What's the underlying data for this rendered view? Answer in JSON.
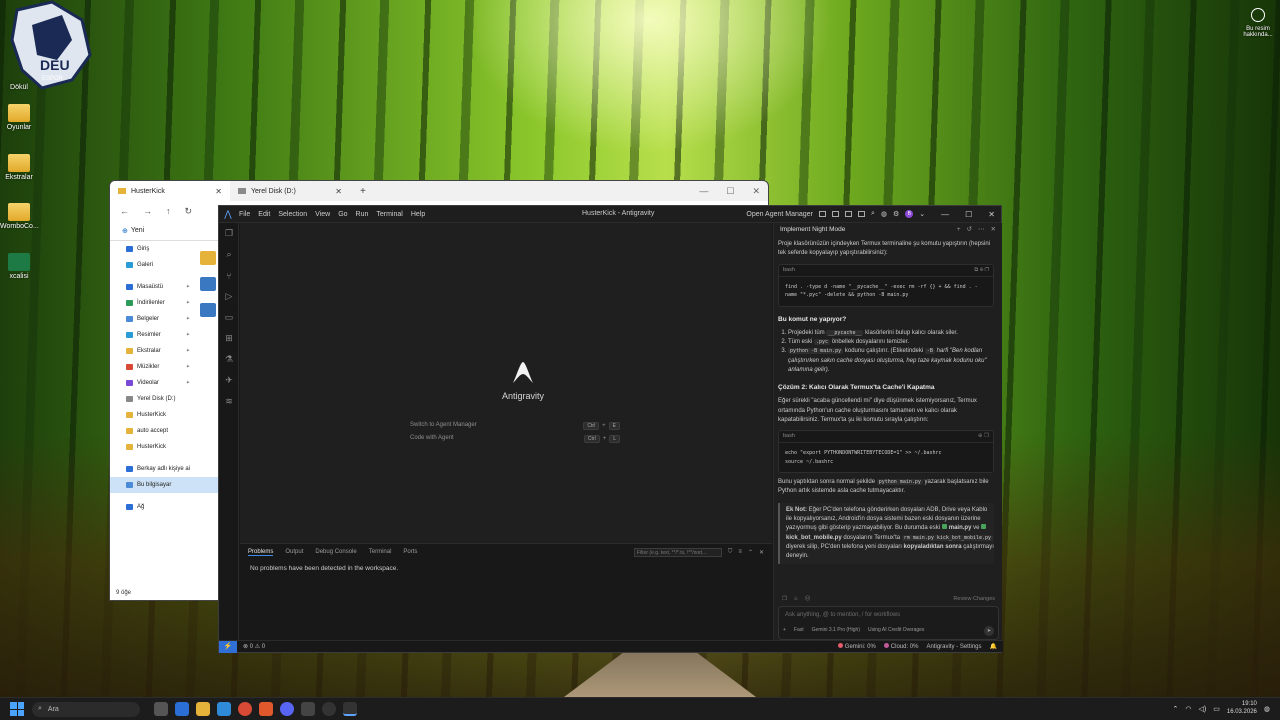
{
  "desktop": {
    "icons": [
      {
        "label": "Oyunlar"
      },
      {
        "label": "Ekstralar"
      },
      {
        "label": "WomboCo..."
      },
      {
        "label": "xcalisi"
      }
    ],
    "partial_label_top": "Dökül",
    "logo_text": "DEU ESPOR",
    "bing_label": "Bu resim hakkında..."
  },
  "explorer": {
    "tabs": [
      {
        "label": "HusterKick"
      },
      {
        "label": "Yerel Disk (D:)"
      }
    ],
    "new_tab": "+",
    "new_label": "Yeni",
    "sidebar": [
      "Giriş",
      "Galeri",
      "Masaüstü",
      "İndirilenler",
      "Belgeler",
      "Resimler",
      "Ekstralar",
      "Müzikler",
      "Videolar",
      "Yerel Disk (D:)",
      "HusterKick",
      "auto accept",
      "HusterKick",
      "Berkay adlı kişiye ai",
      "Bu bilgisayar",
      "Ağ"
    ],
    "status": "9 öğe"
  },
  "ide": {
    "menu": [
      "File",
      "Edit",
      "Selection",
      "View",
      "Go",
      "Run",
      "Terminal",
      "Help"
    ],
    "window_title": "HusterKick - Antigravity",
    "open_agent_manager": "Open Agent Manager",
    "avatar": "B",
    "brand": "Antigravity",
    "shortcuts": [
      {
        "label": "Switch to Agent Manager",
        "key1": "Ctrl",
        "key2": "E"
      },
      {
        "label": "Code with Agent",
        "key1": "Ctrl",
        "key2": "L"
      }
    ],
    "panel": {
      "tabs": [
        "Problems",
        "Output",
        "Debug Console",
        "Terminal",
        "Ports"
      ],
      "filter_placeholder": "Filter (e.g. text, **/*.ts, !**/nod...",
      "message": "No problems have been detected in the workspace."
    },
    "status": {
      "errors": "0",
      "warnings": "0",
      "gemini": "Gemini: 0%",
      "cloud": "Cloud: 0%",
      "settings": "Antigravity - Settings"
    }
  },
  "agent": {
    "title": "Implement Night Mode",
    "intro": "Proje klasörünüzün içindeyken Termux terminaline şu komutu yapıştırın (hepsini tek seferde kopyalayıp yapıştırabilirsiniz):",
    "code1_lang": "bash",
    "code1": "find . -type d -name \"__pycache__\" -exec rm -rf {} + && find . -name \"*.pyc\" -delete && python -B main.py",
    "h1": "Bu komut ne yapıyor?",
    "li1_a": "Projedeki tüm ",
    "li1_code": "__pycache__",
    "li1_b": " klasörlerini bulup kalıcı olarak siler.",
    "li2_a": "Tüm eski ",
    "li2_code": ".pyc",
    "li2_b": " önbellek dosyalarını temizler.",
    "li3_code": "python -B main.py",
    "li3_a": " kodunu çalıştırır. (Etiketindeki ",
    "li3_code2": "-B",
    "li3_b": " harfi \"Ben kodları çalıştırırken sakın cache dosyası oluşturma, hep taze kaymak kodunu oku\" anlamına gelir).",
    "h2": "Çözüm 2: Kalıcı Olarak Termux'ta Cache'i Kapatma",
    "p2": "Eğer sürekli \"acaba güncellendi mi\" diye düşünmek istemiyorsanız, Termux ortamında Python'un cache oluşturmasını tamamen ve kalıcı olarak kapatabilirsiniz. Termux'ta şu iki komutu sırayla çalıştırın:",
    "code2_lang": "bash",
    "code2": "echo \"export PYTHONDONTWRITEBYTECODE=1\" >> ~/.bashrc\nsource ~/.bashrc",
    "p3_a": "Bunu yaptıktan sonra normal şekilde ",
    "p3_code": "python main.py",
    "p3_b": " yazarak başlatsanız bile Python artık sistemde asla cache tutmayacaktır.",
    "note_title": "Ek Not:",
    "note_a": " Eğer PC'den telefona gönderirken dosyaları ADB, Drive veya Kablo ile kopyalıyorsanız, Android'in dosya sistemi bazen eski dosyanın üzerine yazıyormuş gibi gösterip yazmayabiliyor. Bu durumda eski ",
    "file1": "main.py",
    "note_b": " ve ",
    "file2": "kick_bot_mobile.py",
    "note_c": " dosyalarını Termux'ta ",
    "note_code": "rm main.py kick_bot_mobile.py",
    "note_d": " diyerek silip, PC'den telefona yeni dosyaları ",
    "note_bold": "kopyaladıktan sonra",
    "note_e": " çalıştırmayı deneyin.",
    "review": "Review Changes",
    "input_placeholder": "Ask anything, @ to mention, / for workflows",
    "mode": "Fast",
    "model": "Gemini 3.1 Pro (High)",
    "credits": "Using AI Credit Overages"
  },
  "taskbar": {
    "search": "Ara",
    "time": "19:10",
    "date": "16.03.2026"
  }
}
